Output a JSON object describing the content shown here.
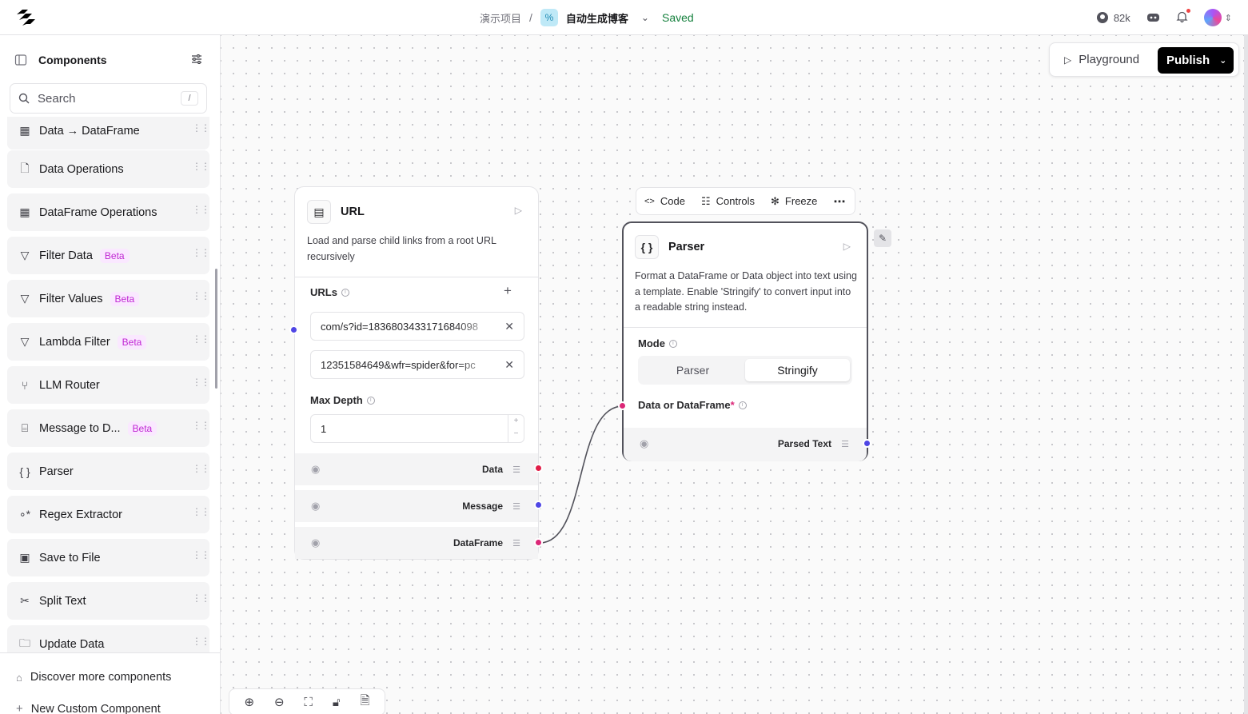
{
  "header": {
    "project": "演示项目",
    "separator": "/",
    "flow_name": "自动生成博客",
    "status": "Saved",
    "github_stars": "82k"
  },
  "sidebar": {
    "title": "Components",
    "search_placeholder": "Search",
    "search_shortcut": "/",
    "items": [
      {
        "label": "Data → DataFrame",
        "icon": "table-icon",
        "badge": ""
      },
      {
        "label": "Data Operations",
        "icon": "file-code-icon",
        "badge": ""
      },
      {
        "label": "DataFrame Operations",
        "icon": "table-icon",
        "badge": ""
      },
      {
        "label": "Filter Data",
        "icon": "filter-icon",
        "badge": "Beta"
      },
      {
        "label": "Filter Values",
        "icon": "filter-icon",
        "badge": "Beta"
      },
      {
        "label": "Lambda Filter",
        "icon": "filter-icon",
        "badge": "Beta"
      },
      {
        "label": "LLM Router",
        "icon": "git-branch-icon",
        "badge": ""
      },
      {
        "label": "Message to D...",
        "icon": "message-icon",
        "badge": "Beta"
      },
      {
        "label": "Parser",
        "icon": "braces-icon",
        "badge": ""
      },
      {
        "label": "Regex Extractor",
        "icon": "regex-icon",
        "badge": ""
      },
      {
        "label": "Save to File",
        "icon": "save-icon",
        "badge": ""
      },
      {
        "label": "Split Text",
        "icon": "scissors-icon",
        "badge": ""
      },
      {
        "label": "Update Data",
        "icon": "folder-sync-icon",
        "badge": ""
      }
    ],
    "discover": "Discover more components",
    "new_custom": "New Custom Component"
  },
  "toolbar": {
    "playground": "Playground",
    "publish": "Publish"
  },
  "url_node": {
    "title": "URL",
    "description": "Load and parse child links from a root URL recursively",
    "urls_label": "URLs",
    "urls": [
      "com/s?id=1836803433171684098",
      "12351584649&wfr=spider&for=pc"
    ],
    "max_depth_label": "Max Depth",
    "max_depth_value": "1",
    "outputs": [
      "Data",
      "Message",
      "DataFrame"
    ]
  },
  "parser_node": {
    "toolbar": {
      "code": "Code",
      "controls": "Controls",
      "freeze": "Freeze"
    },
    "title": "Parser",
    "description": "Format a DataFrame or Data object into text using a template. Enable 'Stringify' to convert input into a readable string instead.",
    "mode_label": "Mode",
    "mode_options": [
      "Parser",
      "Stringify"
    ],
    "mode_selected": "Stringify",
    "input_label": "Data or DataFrame",
    "required_mark": "*",
    "output": "Parsed Text"
  },
  "colors": {
    "port_data": "#e11d48",
    "port_message": "#4f46e5",
    "port_dataframe": "#db2777",
    "beta": "#c026d3",
    "saved": "#15803d"
  }
}
